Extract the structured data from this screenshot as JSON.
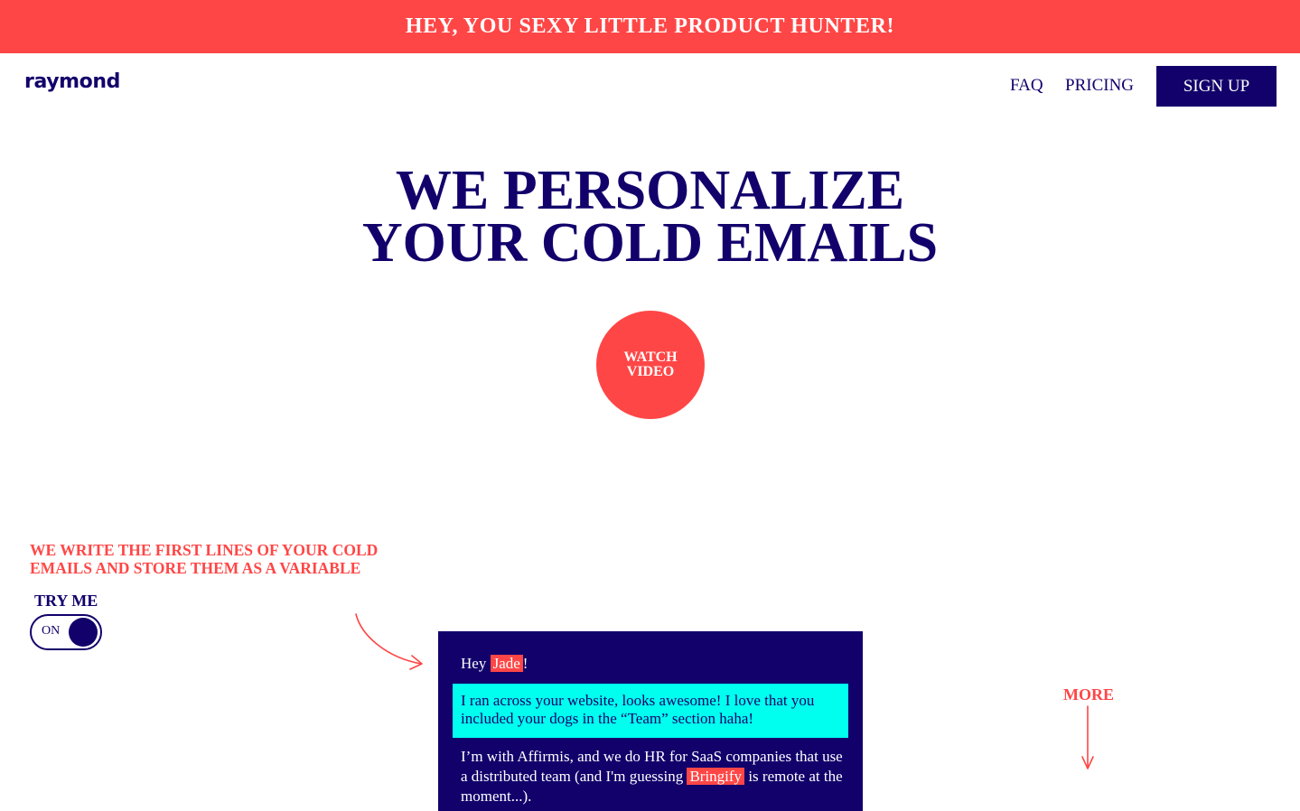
{
  "banner": {
    "text": "HEY, YOU SEXY LITTLE PRODUCT HUNTER!"
  },
  "header": {
    "logo": "raymond",
    "nav": {
      "faq": "FAQ",
      "pricing": "PRICING"
    },
    "signup_label": "SIGN UP"
  },
  "hero": {
    "title_line1": "WE PERSONALIZE",
    "title_line2": "YOUR COLD EMAILS",
    "watch_line1": "WATCH",
    "watch_line2": "VIDEO"
  },
  "feature": {
    "caption": "WE WRITE THE FIRST LINES OF YOUR COLD EMAILS AND STORE THEM AS A VARIABLE",
    "try_me": "TRY ME",
    "toggle_state": "ON"
  },
  "email": {
    "greeting_prefix": "Hey ",
    "name_variable": "Jade",
    "greeting_suffix": "!",
    "highlight": "I ran across your website, looks awesome! I love that you included your dogs in the “Team” section haha!",
    "body_prefix": "I’m with Affirmis, and we do HR for SaaS companies that use a distributed team (and I'm guessing ",
    "company_variable": "Bringify",
    "body_suffix": " is remote at the moment...)."
  },
  "more_label": "MORE",
  "colors": {
    "accent": "#ff4646",
    "navy": "#12006b",
    "cyan": "#00ffee"
  },
  "icons": {
    "curved_arrow": "curved-arrow-icon",
    "down_arrow": "down-arrow-icon"
  }
}
